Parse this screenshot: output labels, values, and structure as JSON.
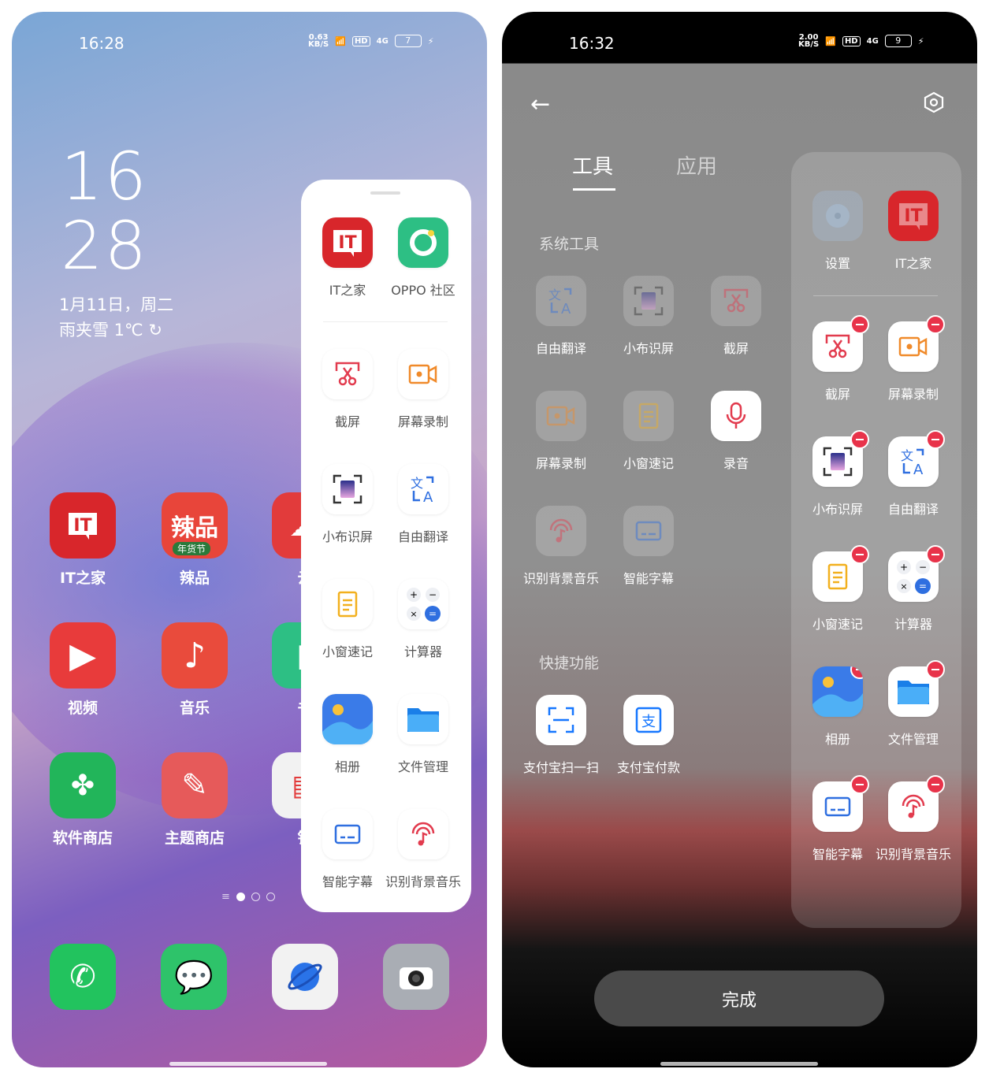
{
  "left": {
    "status": {
      "time": "16:28",
      "speed": "0.63",
      "speed_unit": "KB/S",
      "hd": "HD",
      "net": "4G",
      "battery": "7"
    },
    "clock": {
      "hour": "16",
      "minute": "28",
      "date": "1月11日，周二",
      "weather": "雨夹雪 1℃"
    },
    "home_apps": [
      {
        "label": "IT之家",
        "icon": "ithome-icon",
        "color": "#d8262b"
      },
      {
        "label": "辣品",
        "icon": "lapin-icon",
        "color": "#e8453a"
      },
      {
        "label": "云",
        "icon": "cloud-icon",
        "color": "#e23b3b"
      },
      {
        "label": "视频",
        "icon": "video-play-icon",
        "color": "#e83b3b"
      },
      {
        "label": "音乐",
        "icon": "music-icon",
        "color": "#e94b3c"
      },
      {
        "label": "书",
        "icon": "book-icon",
        "color": "#2dbf84"
      },
      {
        "label": "软件商店",
        "icon": "app-store-icon",
        "color": "#22b55a"
      },
      {
        "label": "主题商店",
        "icon": "theme-store-icon",
        "color": "#e65a5a"
      },
      {
        "label": "钱",
        "icon": "wallet-icon",
        "color": "#f2f2f2"
      }
    ],
    "lapin_badge": "年货节",
    "page_indicator": {
      "count": 3,
      "active": 0
    },
    "dock": [
      {
        "icon": "phone-icon",
        "color": "#22c35e"
      },
      {
        "icon": "messages-icon",
        "color": "#2ec36a"
      },
      {
        "icon": "browser-icon",
        "color": "#f2f2f2"
      },
      {
        "icon": "camera-icon",
        "color": "#a9adb4"
      }
    ],
    "sidebar": {
      "top": [
        {
          "label": "IT之家",
          "icon": "ithome-icon"
        },
        {
          "label": "OPPO 社区",
          "icon": "oppo-community-icon"
        }
      ],
      "items": [
        {
          "label": "截屏",
          "icon": "screenshot-icon"
        },
        {
          "label": "屏幕录制",
          "icon": "screen-record-icon"
        },
        {
          "label": "小布识屏",
          "icon": "screen-recognize-icon"
        },
        {
          "label": "自由翻译",
          "icon": "translate-icon"
        },
        {
          "label": "小窗速记",
          "icon": "quick-note-icon"
        },
        {
          "label": "计算器",
          "icon": "calculator-icon"
        },
        {
          "label": "相册",
          "icon": "gallery-icon"
        },
        {
          "label": "文件管理",
          "icon": "files-icon"
        },
        {
          "label": "智能字幕",
          "icon": "subtitle-icon"
        },
        {
          "label": "识别背景音乐",
          "icon": "music-recognize-icon"
        }
      ]
    }
  },
  "right": {
    "status": {
      "time": "16:32",
      "speed": "2.00",
      "speed_unit": "KB/S",
      "hd": "HD",
      "net": "4G",
      "battery": "9"
    },
    "tabs": [
      {
        "label": "工具",
        "active": true
      },
      {
        "label": "应用",
        "active": false
      }
    ],
    "sections": [
      {
        "title": "系统工具",
        "items": [
          {
            "label": "自由翻译",
            "icon": "translate-icon",
            "added": true
          },
          {
            "label": "小布识屏",
            "icon": "screen-recognize-icon",
            "added": true
          },
          {
            "label": "截屏",
            "icon": "screenshot-icon",
            "added": true
          },
          {
            "label": "屏幕录制",
            "icon": "screen-record-icon",
            "added": true
          },
          {
            "label": "小窗速记",
            "icon": "quick-note-icon",
            "added": true
          },
          {
            "label": "录音",
            "icon": "recorder-icon",
            "added": false
          },
          {
            "label": "识别背景音乐",
            "icon": "music-recognize-icon",
            "added": true
          },
          {
            "label": "智能字幕",
            "icon": "subtitle-icon",
            "added": true
          }
        ]
      },
      {
        "title": "快捷功能",
        "items": [
          {
            "label": "支付宝扫一扫",
            "icon": "alipay-scan-icon",
            "added": false
          },
          {
            "label": "支付宝付款",
            "icon": "alipay-pay-icon",
            "added": false
          }
        ]
      }
    ],
    "sidebar_preview": {
      "fixed": [
        {
          "label": "设置",
          "icon": "settings-icon"
        },
        {
          "label": "IT之家",
          "icon": "ithome-icon"
        }
      ],
      "items": [
        {
          "label": "截屏",
          "icon": "screenshot-icon"
        },
        {
          "label": "屏幕录制",
          "icon": "screen-record-icon"
        },
        {
          "label": "小布识屏",
          "icon": "screen-recognize-icon"
        },
        {
          "label": "自由翻译",
          "icon": "translate-icon"
        },
        {
          "label": "小窗速记",
          "icon": "quick-note-icon"
        },
        {
          "label": "计算器",
          "icon": "calculator-icon"
        },
        {
          "label": "相册",
          "icon": "gallery-icon"
        },
        {
          "label": "文件管理",
          "icon": "files-icon"
        },
        {
          "label": "智能字幕",
          "icon": "subtitle-icon"
        },
        {
          "label": "识别背景音乐",
          "icon": "music-recognize-icon"
        }
      ]
    },
    "done_label": "完成"
  },
  "colors": {
    "accent_red": "#e8334a",
    "blue": "#2f6fe0"
  }
}
